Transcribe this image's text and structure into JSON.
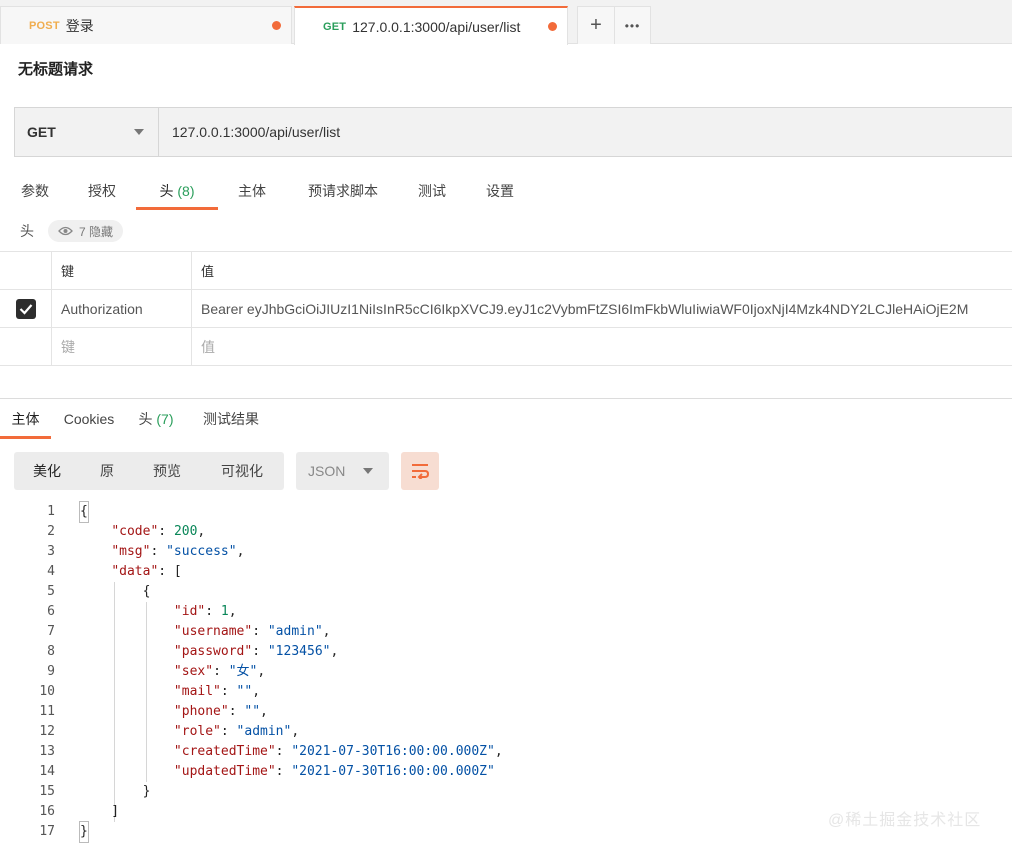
{
  "tabs": [
    {
      "method": "POST",
      "title": "登录"
    },
    {
      "method": "GET",
      "title": "127.0.0.1:3000/api/user/list"
    }
  ],
  "tab_actions": {
    "add": "+",
    "more": "•••"
  },
  "request_title": "无标题请求",
  "method": "GET",
  "url": "127.0.0.1:3000/api/user/list",
  "request_tabs": [
    {
      "label": "参数"
    },
    {
      "label": "授权"
    },
    {
      "label": "头",
      "count": "(8)"
    },
    {
      "label": "主体"
    },
    {
      "label": "预请求脚本"
    },
    {
      "label": "测试"
    },
    {
      "label": "设置"
    }
  ],
  "headers_section": {
    "label": "头",
    "hidden": "7 隐藏"
  },
  "headers_table": {
    "key_col": "键",
    "value_col": "值",
    "rows": [
      {
        "key": "Authorization",
        "value": "Bearer eyJhbGciOiJIUzI1NiIsInR5cCI6IkpXVCJ9.eyJ1c2VybmFtZSI6ImFkbWluIiwiaWF0IjoxNjI4Mzk4NDY2LCJleHAiOjE2M"
      }
    ],
    "placeholder_key": "键",
    "placeholder_value": "值"
  },
  "response_tabs": [
    {
      "label": "主体"
    },
    {
      "label": "Cookies"
    },
    {
      "label": "头",
      "count": "(7)"
    },
    {
      "label": "测试结果"
    }
  ],
  "format_buttons": [
    "美化",
    "原",
    "预览",
    "可视化"
  ],
  "format_select": "JSON",
  "code_lines": [
    "{",
    "    \"code\": 200,",
    "    \"msg\": \"success\",",
    "    \"data\": [",
    "        {",
    "            \"id\": 1,",
    "            \"username\": \"admin\",",
    "            \"password\": \"123456\",",
    "            \"sex\": \"女\",",
    "            \"mail\": \"\",",
    "            \"phone\": \"\",",
    "            \"role\": \"admin\",",
    "            \"createdTime\": \"2021-07-30T16:00:00.000Z\",",
    "            \"updatedTime\": \"2021-07-30T16:00:00.000Z\"",
    "        }",
    "    ]",
    "}"
  ],
  "colors": {
    "accent": "#f26b3a",
    "get": "#2a9e5b",
    "post": "#f0ad4e"
  },
  "watermark": "@稀土掘金技术社区"
}
